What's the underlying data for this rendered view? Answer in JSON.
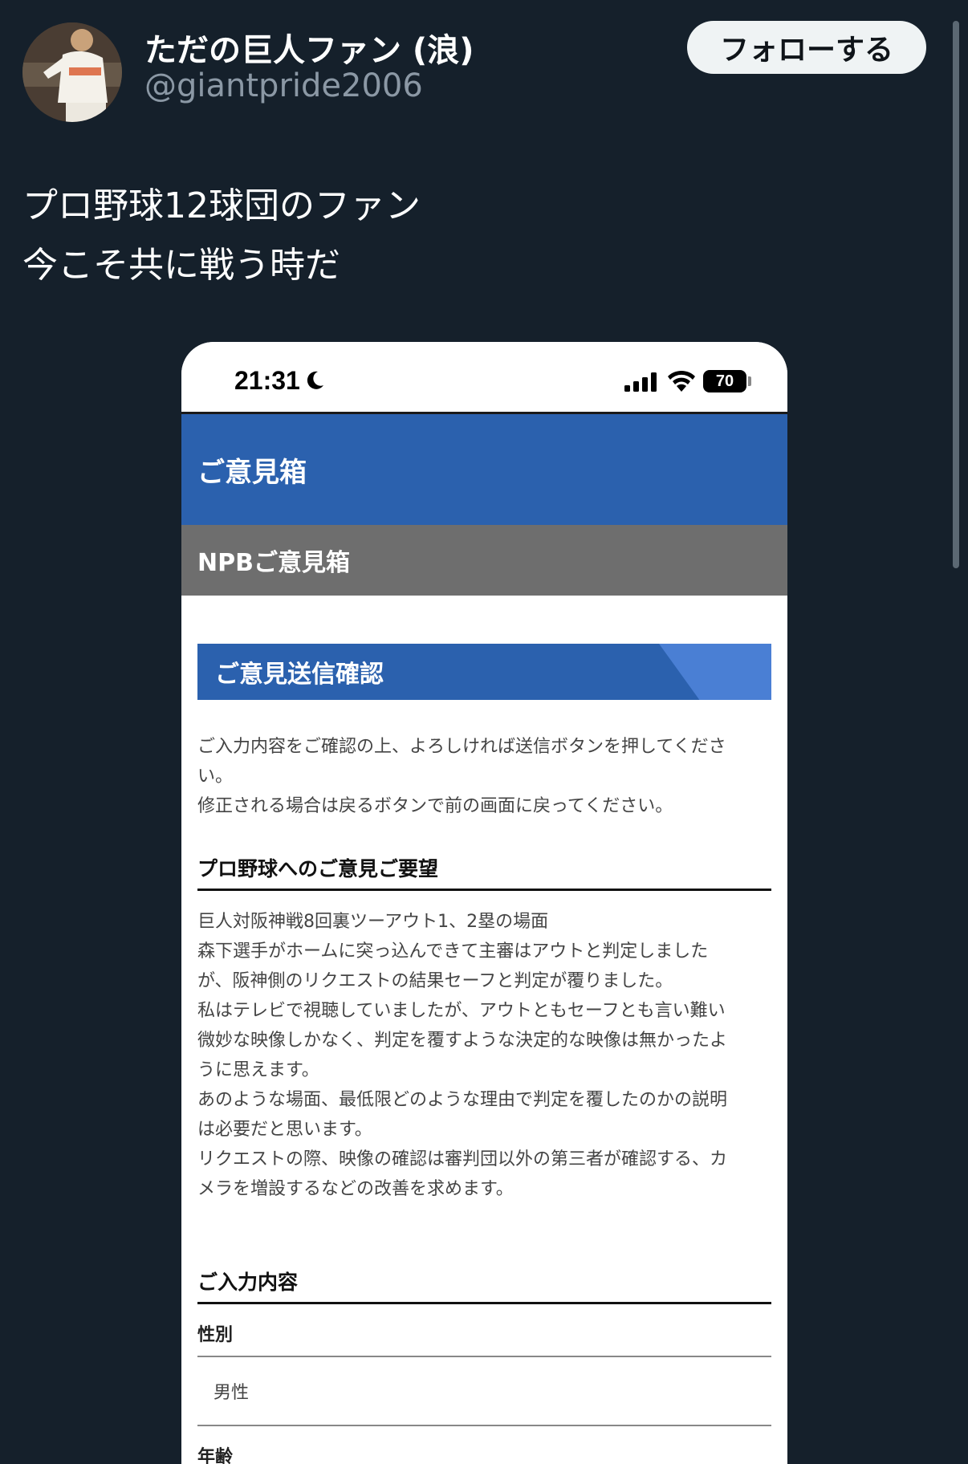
{
  "tweet": {
    "display_name": "ただの巨人ファン (浪)",
    "handle": "@giantpride2006",
    "follow_label": "フォローする",
    "text_lines": [
      "プロ野球12球団のファン",
      "今こそ共に戦う時だ"
    ]
  },
  "screenshot": {
    "status_bar": {
      "time": "21:31",
      "battery": "70"
    },
    "header_title": "ご意見箱",
    "sub_header": "NPBご意見箱",
    "section_title": "ご意見送信確認",
    "intro_lines": [
      "ご入力内容をご確認の上、よろしければ送信ボタンを押してくださ",
      "い。",
      "修正される場合は戻るボタンで前の画面に戻ってください。"
    ],
    "opinion_heading": "プロ野球へのご意見ご要望",
    "opinion_lines": [
      "巨人対阪神戦8回裏ツーアウト1、2塁の場面",
      "森下選手がホームに突っ込んできて主審はアウトと判定しました",
      "が、阪神側のリクエストの結果セーフと判定が覆りました。",
      "私はテレビで視聴していましたが、アウトともセーフとも言い難い",
      "微妙な映像しかなく、判定を覆すような決定的な映像は無かったよ",
      "うに思えます。",
      "あのような場面、最低限どのような理由で判定を覆したのかの説明",
      "は必要だと思います。",
      "リクエストの際、映像の確認は審判団以外の第三者が確認する、カ",
      "メラを増設するなどの改善を求めます。"
    ],
    "input_heading": "ご入力内容",
    "fields": [
      {
        "label": "性別",
        "value": "男性"
      },
      {
        "label": "年齢",
        "value": ""
      }
    ]
  },
  "colors": {
    "page_bg": "#15202b",
    "header_blue": "#2b61ae",
    "sub_header_gray": "#6e6e6e",
    "follow_button_bg": "#eff3f4"
  },
  "icons": [
    "avatar-photo",
    "moon-icon",
    "cellular-signal-icon",
    "wifi-icon",
    "battery-icon"
  ]
}
